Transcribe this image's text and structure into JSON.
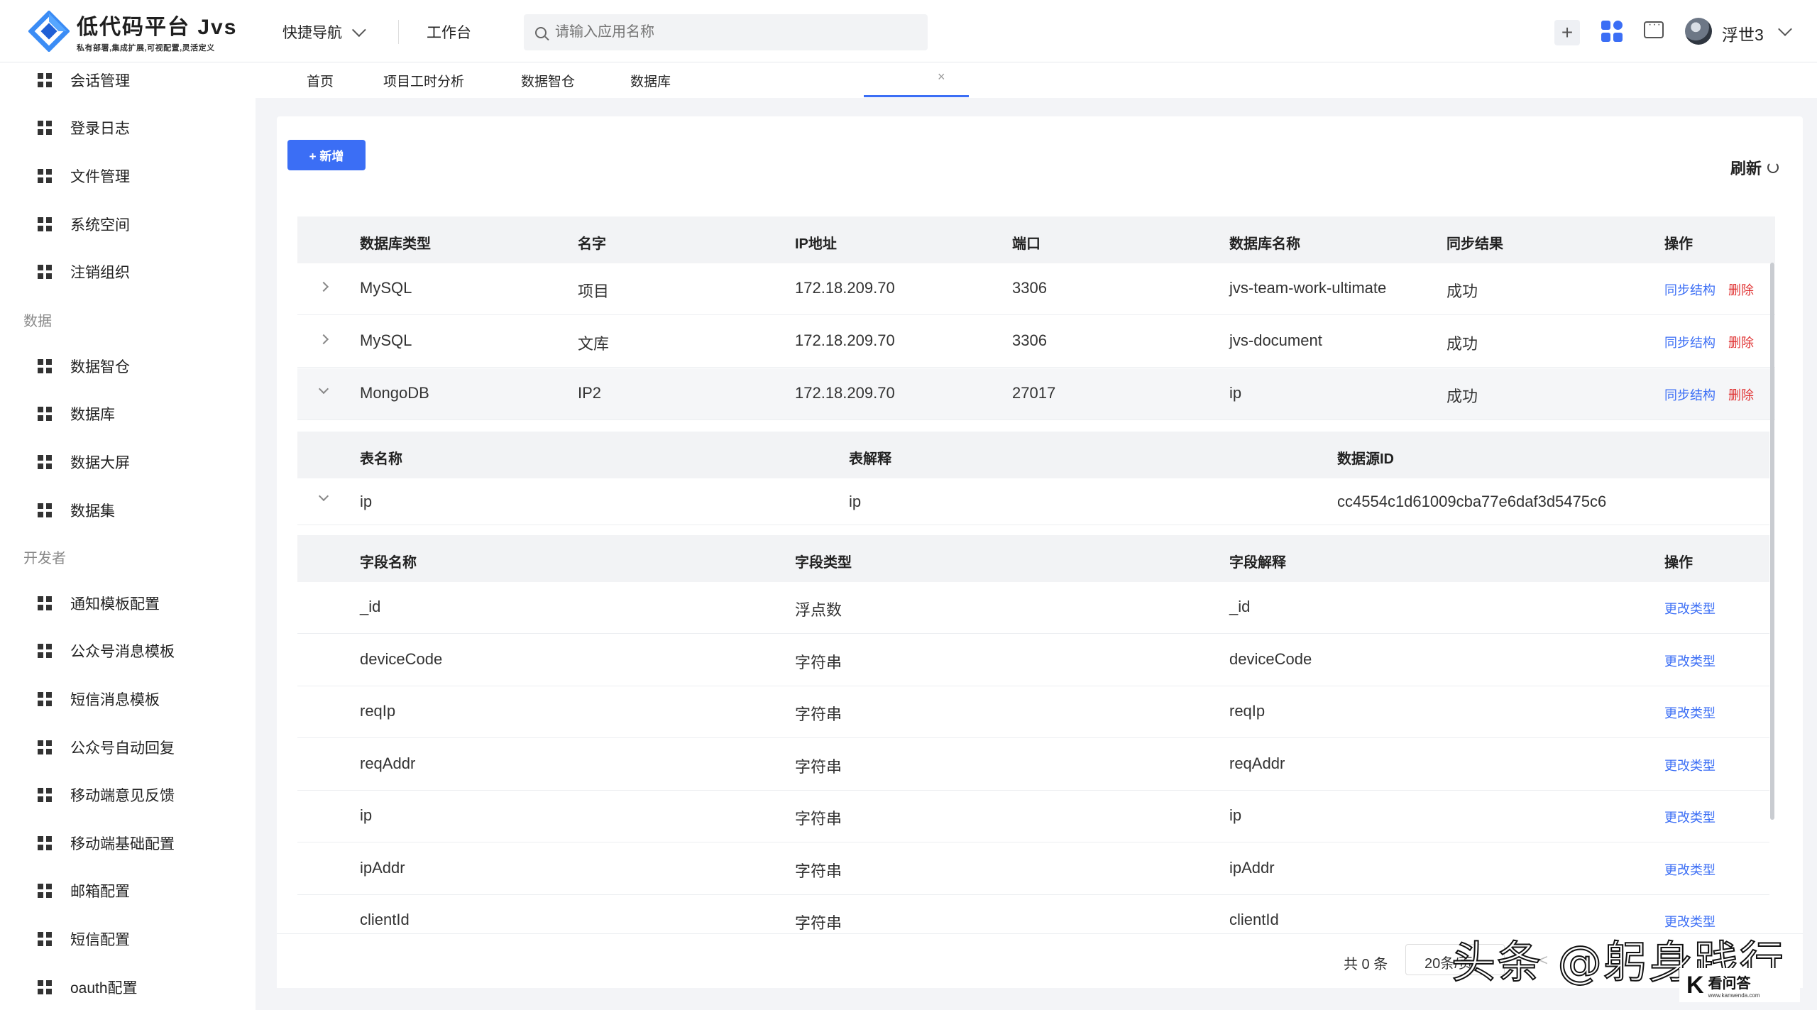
{
  "header": {
    "logo_title": "低代码平台 Jvs",
    "logo_subtitle": "私有部署,集成扩展,可视配置,灵活定义",
    "quick_nav": "快捷导航",
    "workbench": "工作台",
    "search_placeholder": "请输入应用名称",
    "plus": "+",
    "username": "浮世3"
  },
  "sidebar": {
    "items_top": [
      "会话管理",
      "登录日志",
      "文件管理",
      "系统空间",
      "注销组织"
    ],
    "group_data": "数据",
    "items_data": [
      "数据智仓",
      "数据库",
      "数据大屏",
      "数据集"
    ],
    "group_dev": "开发者",
    "items_dev": [
      "通知模板配置",
      "公众号消息模板",
      "短信消息模板",
      "公众号自动回复",
      "移动端意见反馈",
      "移动端基础配置",
      "邮箱配置",
      "短信配置",
      "oauth配置"
    ]
  },
  "tabs": [
    "首页",
    "项目工时分析",
    "数据智仓",
    "数据库"
  ],
  "tab_close": "×",
  "toolbar": {
    "add": "+ 新增",
    "refresh": "刷新"
  },
  "table": {
    "headers": [
      "数据库类型",
      "名字",
      "IP地址",
      "端口",
      "数据库名称",
      "同步结果",
      "操作"
    ],
    "rows": [
      {
        "type": "MySQL",
        "name": "项目",
        "ip": "172.18.209.70",
        "port": "3306",
        "db": "jvs-team-work-ultimate",
        "result": "成功"
      },
      {
        "type": "MySQL",
        "name": "文库",
        "ip": "172.18.209.70",
        "port": "3306",
        "db": "jvs-document",
        "result": "成功"
      },
      {
        "type": "MongoDB",
        "name": "IP2",
        "ip": "172.18.209.70",
        "port": "27017",
        "db": "ip",
        "result": "成功"
      }
    ],
    "action_sync": "同步结构",
    "action_delete": "删除"
  },
  "subtable": {
    "headers": [
      "表名称",
      "表解释",
      "数据源ID"
    ],
    "row": {
      "name": "ip",
      "desc": "ip",
      "source_id": "cc4554c1d61009cba77e6daf3d5475c6"
    }
  },
  "fields": {
    "headers": [
      "字段名称",
      "字段类型",
      "字段解释",
      "操作"
    ],
    "rows": [
      {
        "name": "_id",
        "type": "浮点数",
        "desc": "_id"
      },
      {
        "name": "deviceCode",
        "type": "字符串",
        "desc": "deviceCode"
      },
      {
        "name": "reqIp",
        "type": "字符串",
        "desc": "reqIp"
      },
      {
        "name": "reqAddr",
        "type": "字符串",
        "desc": "reqAddr"
      },
      {
        "name": "ip",
        "type": "字符串",
        "desc": "ip"
      },
      {
        "name": "ipAddr",
        "type": "字符串",
        "desc": "ipAddr"
      },
      {
        "name": "clientId",
        "type": "字符串",
        "desc": "clientId"
      }
    ],
    "action": "更改类型"
  },
  "pagination": {
    "total": "共 0 条",
    "page_size": "20条/页",
    "prev": "<"
  },
  "watermark": {
    "text": "头条 @躬身践行",
    "logo_k": "K",
    "logo_t1": "看问答",
    "logo_t2": "www.kanwenda.com"
  },
  "colors": {
    "primary": "#3b6ef5",
    "danger": "#e03333"
  }
}
